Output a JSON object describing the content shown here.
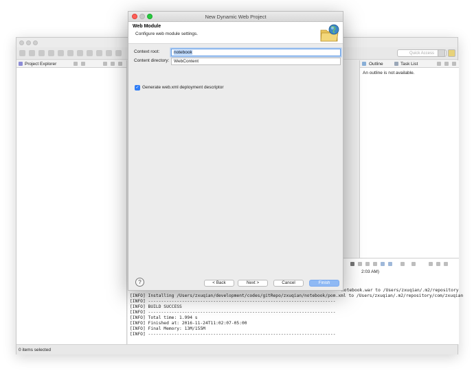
{
  "eclipse": {
    "quick_access_placeholder": "Quick Access",
    "project_explorer_tab": "Project Explorer",
    "outline_tab": "Outline",
    "task_list_tab": "Task List",
    "outline_message": "An outline is not available.",
    "console_time": "2:03 AM)",
    "console_lines": [
      "[INFO] Installing /Users/zxuqian/development/codes/gitRepo/zxuqian/notebook/pom.xml to /Users/zxuqian/.m2/repository/com/zxuqian",
      "[INFO] ------------------------------------------------------------------------",
      "[INFO] BUILD SUCCESS",
      "[INFO] ------------------------------------------------------------------------",
      "[INFO] Total time: 1.994 s",
      "[INFO] Finished at: 2016-11-24T11:02:07-05:00",
      "[INFO] Final Memory: 13M/155M",
      "[INFO] ------------------------------------------------------------------------"
    ],
    "console_right_line": "notebook.war to /Users/zxuqian/.m2/repository",
    "status_text": "0 items selected"
  },
  "dialog": {
    "title": "New Dynamic Web Project",
    "header_title": "Web Module",
    "header_description": "Configure web module settings.",
    "context_root_label": "Context root:",
    "context_root_value": "notebook",
    "content_directory_label": "Content directory:",
    "content_directory_value": "WebContent",
    "generate_checkbox_label": "Generate web.xml deployment descriptor",
    "generate_checked": true,
    "help_glyph": "?",
    "buttons": {
      "back": "< Back",
      "next": "Next >",
      "cancel": "Cancel",
      "finish": "Finish"
    }
  },
  "colors": {
    "accent": "#2f7df6",
    "finish_disabled": "#8fb9f4",
    "close": "#fd5e57",
    "minimize": "#febb2e",
    "zoom": "#28c840"
  },
  "icons": [
    "web-module-globe-folder-icon",
    "help-icon",
    "checkmark-icon"
  ]
}
